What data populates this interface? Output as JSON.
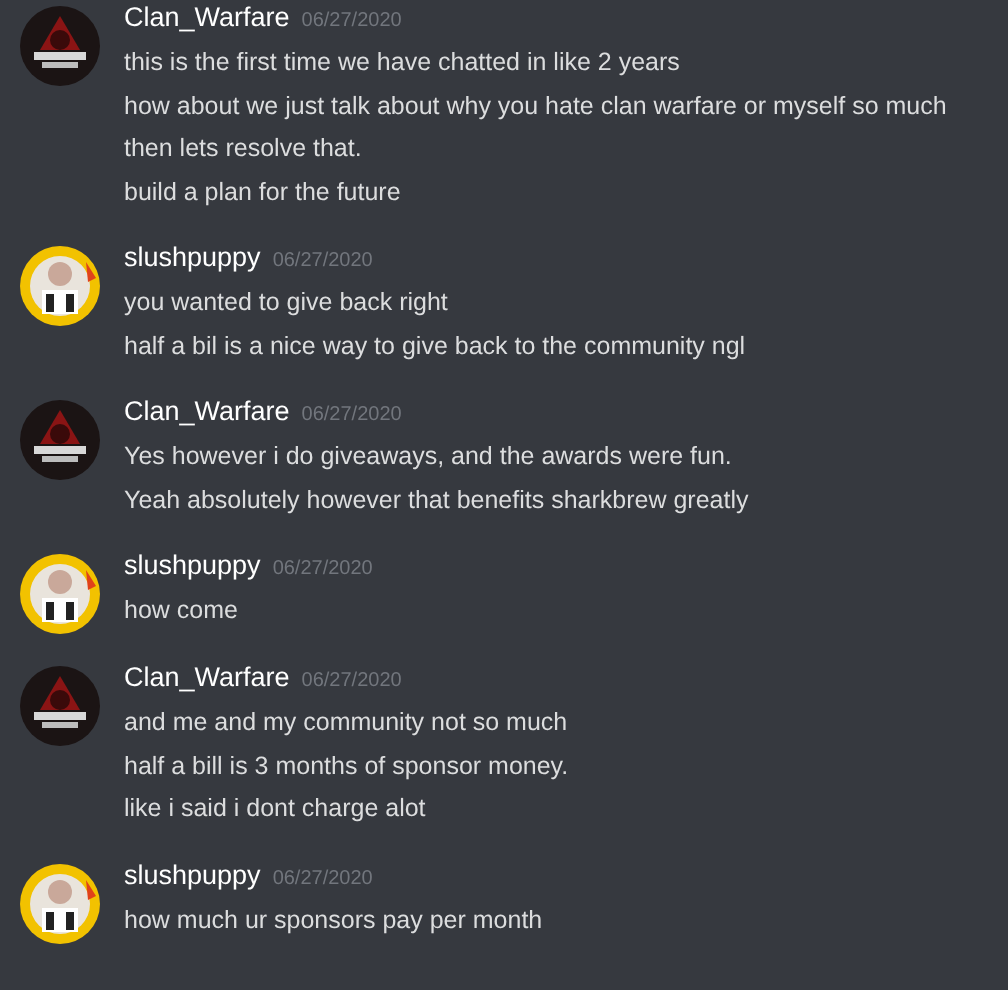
{
  "messages": [
    {
      "author": "Clan_Warfare",
      "kind": "clan",
      "timestamp": "06/27/2020",
      "lines": [
        "this is the first time we have chatted in like 2 years",
        "how about we just talk about why you hate clan warfare or myself so much",
        "then lets resolve that.",
        "build a plan for the future"
      ]
    },
    {
      "author": "slushpuppy",
      "kind": "slush",
      "timestamp": "06/27/2020",
      "lines": [
        "you wanted to give back right",
        "half a bil is a nice way to give back to the community ngl"
      ]
    },
    {
      "author": "Clan_Warfare",
      "kind": "clan",
      "timestamp": "06/27/2020",
      "lines": [
        "Yes however i do giveaways, and the awards were fun.",
        "Yeah absolutely however that benefits sharkbrew greatly"
      ]
    },
    {
      "author": "slushpuppy",
      "kind": "slush",
      "timestamp": "06/27/2020",
      "lines": [
        "how come"
      ]
    },
    {
      "author": "Clan_Warfare",
      "kind": "clan",
      "timestamp": "06/27/2020",
      "lines": [
        "and me and my community not so much",
        "half a bill is 3 months of sponsor money.",
        "like i  said i dont charge alot"
      ]
    },
    {
      "author": "slushpuppy",
      "kind": "slush",
      "timestamp": "06/27/2020",
      "lines": [
        "how much ur sponsors pay per month"
      ]
    }
  ]
}
